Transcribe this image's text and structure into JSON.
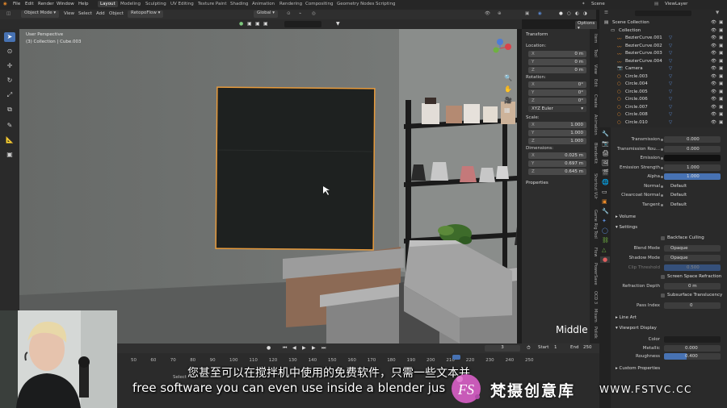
{
  "topbar": {
    "menus": [
      "File",
      "Edit",
      "Render",
      "Window",
      "Help"
    ],
    "workspaces": [
      "Layout",
      "Modeling",
      "Sculpting",
      "UV Editing",
      "Texture Paint",
      "Shading",
      "Animation",
      "Rendering",
      "Compositing",
      "Geometry Nodes",
      "Scripting"
    ],
    "active_workspace": "Layout",
    "scene": "Scene",
    "view_layer": "ViewLayer"
  },
  "header": {
    "mode": "Object Mode",
    "menus": [
      "View",
      "Select",
      "Add",
      "Object"
    ],
    "addon": "RetopoFlow",
    "orientation": "Global",
    "options": "Options"
  },
  "viewport": {
    "view_name": "User Perspective",
    "collection_info": "(3) Collection | Cube.003"
  },
  "npanel": {
    "title": "Transform",
    "location_label": "Location:",
    "location": [
      {
        "axis": "X",
        "value": "0 m"
      },
      {
        "axis": "Y",
        "value": "0 m"
      },
      {
        "axis": "Z",
        "value": "0 m"
      }
    ],
    "rotation_label": "Rotation:",
    "rotation": [
      {
        "axis": "X",
        "value": "0°"
      },
      {
        "axis": "Y",
        "value": "0°"
      },
      {
        "axis": "Z",
        "value": "0°"
      }
    ],
    "rotation_mode": "XYZ Euler",
    "scale_label": "Scale:",
    "scale": [
      {
        "axis": "X",
        "value": "1.000"
      },
      {
        "axis": "Y",
        "value": "1.000"
      },
      {
        "axis": "Z",
        "value": "1.000"
      }
    ],
    "dimensions_label": "Dimensions:",
    "dimensions": [
      {
        "axis": "X",
        "value": "0.025 m"
      },
      {
        "axis": "Y",
        "value": "0.697 m"
      },
      {
        "axis": "Z",
        "value": "0.645 m"
      }
    ],
    "properties": "Properties"
  },
  "sidetabs": [
    "Item",
    "Tool",
    "View",
    "Edit",
    "Create",
    "Animation",
    "BlenderKit",
    "Shortcut VUr",
    "Game Rig Tool",
    "Flow",
    "PowerSave",
    "OCD 3",
    "Mixam",
    "Polidk"
  ],
  "outliner": {
    "search_placeholder": "",
    "rows": [
      {
        "label": "Scene Collection",
        "indent": 0
      },
      {
        "label": "Collection",
        "indent": 1
      },
      {
        "label": "BezierCurve.001",
        "indent": 2
      },
      {
        "label": "BezierCurve.002",
        "indent": 2
      },
      {
        "label": "BezierCurve.003",
        "indent": 2
      },
      {
        "label": "BezierCurve.004",
        "indent": 2
      },
      {
        "label": "Camera",
        "indent": 2
      },
      {
        "label": "Circle.003",
        "indent": 2
      },
      {
        "label": "Circle.004",
        "indent": 2
      },
      {
        "label": "Circle.005",
        "indent": 2
      },
      {
        "label": "Circle.006",
        "indent": 2
      },
      {
        "label": "Circle.007",
        "indent": 2
      },
      {
        "label": "Circle.008",
        "indent": 2
      },
      {
        "label": "Circle.010",
        "indent": 2
      }
    ]
  },
  "props": {
    "rows": [
      {
        "label": "Transmission",
        "value": "0.000",
        "kind": "num"
      },
      {
        "label": "Transmission Rou...",
        "value": "0.000",
        "kind": "num"
      },
      {
        "label": "Emission",
        "value": "",
        "kind": "color-black"
      },
      {
        "label": "Emission Strength",
        "value": "1.000",
        "kind": "num"
      },
      {
        "label": "Alpha",
        "value": "1.000",
        "kind": "blue"
      },
      {
        "label": "Normal",
        "value": "Default",
        "kind": "link"
      },
      {
        "label": "Clearcoat Normal",
        "value": "Default",
        "kind": "link"
      },
      {
        "label": "Tangent",
        "value": "Default",
        "kind": "link"
      }
    ],
    "volume": "Volume",
    "settings": "Settings",
    "backface": "Backface Culling",
    "blend_mode_label": "Blend Mode",
    "blend_mode": "Opaque",
    "shadow_mode_label": "Shadow Mode",
    "shadow_mode": "Opaque",
    "clip_label": "Clip Threshold",
    "clip_value": "0.500",
    "ssr": "Screen Space Refraction",
    "refraction_depth_label": "Refraction Depth",
    "refraction_depth": "0 m",
    "subsurface": "Subsurface Translucency",
    "pass_index_label": "Pass Index",
    "pass_index": "0",
    "line_art": "Line Art",
    "viewport_display": "Viewport Display",
    "vd_color_label": "Color",
    "vd_metallic_label": "Metallic",
    "vd_metallic": "0.000",
    "vd_roughness_label": "Roughness",
    "vd_roughness": "0.400",
    "custom_props": "Custom Properties"
  },
  "timeline": {
    "ticks": [
      "50",
      "60",
      "70",
      "80",
      "90",
      "100",
      "110",
      "120",
      "130",
      "140",
      "150",
      "160",
      "170",
      "180",
      "190",
      "200",
      "210",
      "220",
      "230",
      "240",
      "250"
    ],
    "current_frame": "3",
    "start_label": "Start",
    "start": "1",
    "end_label": "End",
    "end": "250",
    "select_label": "Select"
  },
  "overlay": {
    "middle_label": "Middle",
    "subtitle_cn": "您甚至可以在搅拌机中使用的免费软件，只需一些文本并",
    "subtitle_en": "free software you can even use inside a blender jus",
    "watermark_cn": "梵摄创意库",
    "watermark_url": "WWW.FSTVC.CC",
    "watermark_logo_text": "FS"
  },
  "colors": {
    "accent": "#4772b3",
    "selection": "#f0a030",
    "bg": "#2a2a2a"
  }
}
